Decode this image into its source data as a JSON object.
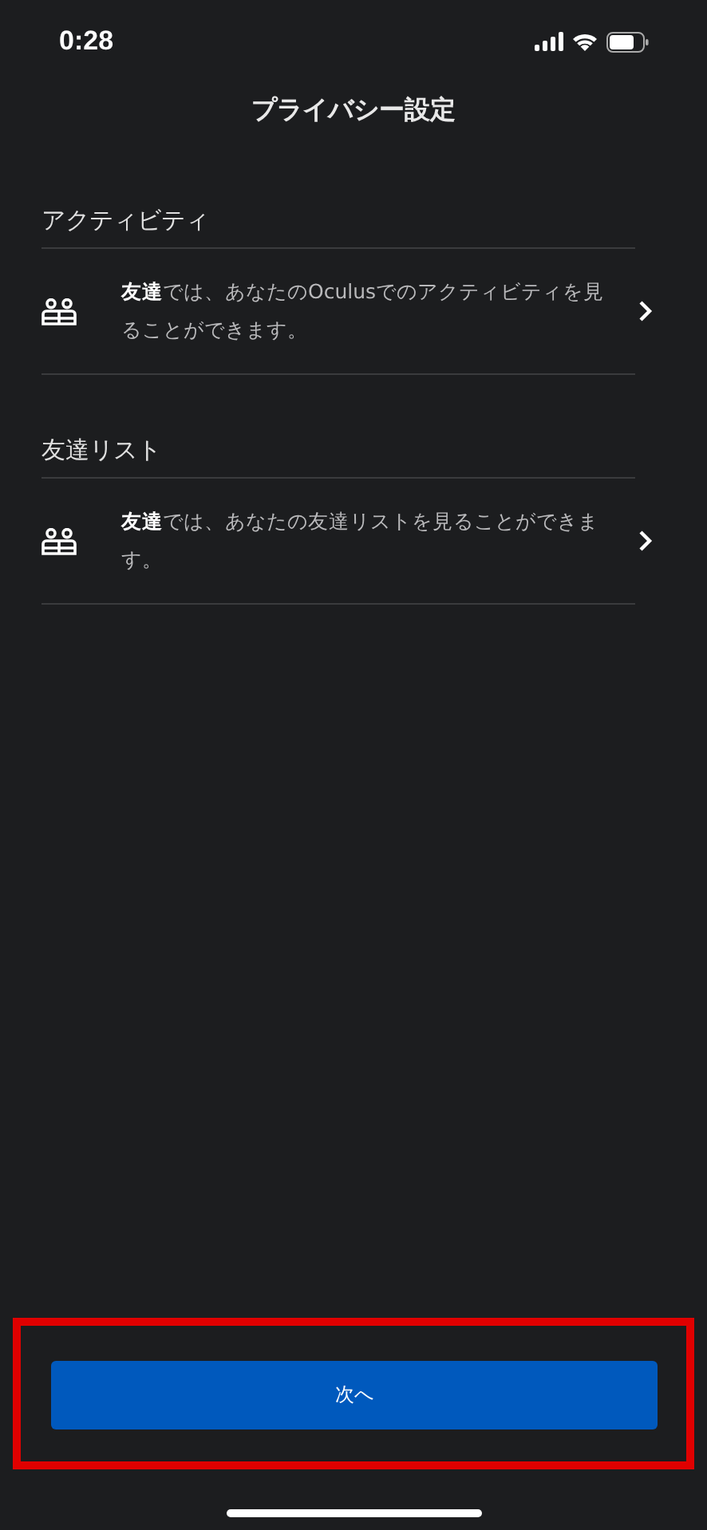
{
  "status_bar": {
    "time": "0:28"
  },
  "title": "プライバシー設定",
  "sections": [
    {
      "header": "アクティビティ",
      "rows": [
        {
          "text": "**友達**では、あなたのOculusでのアクティビティを見ることができます。"
        }
      ]
    },
    {
      "header": "友達リスト",
      "rows": [
        {
          "text": "**友達**では、あなたの友達リストを見ることができます。"
        }
      ]
    }
  ],
  "next_button": "次へ"
}
